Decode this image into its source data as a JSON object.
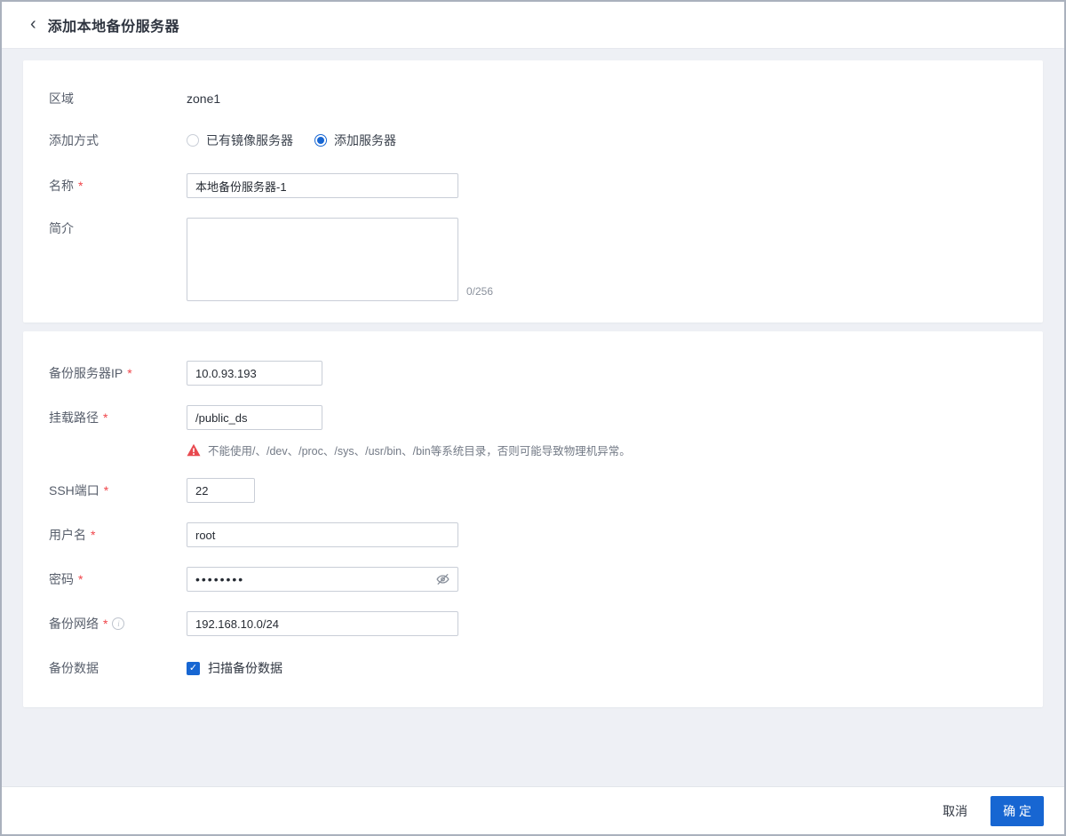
{
  "accent_color": "#1766d2",
  "ui": {
    "required_mark": "*",
    "back_icon": "‹",
    "info_icon": "i",
    "check_icon": "✓"
  },
  "header": {
    "title": "添加本地备份服务器"
  },
  "basic": {
    "zone_label": "区域",
    "zone_value": "zone1",
    "add_method_label": "添加方式",
    "radio_existing_label": "已有镜像服务器",
    "radio_add_label": "添加服务器",
    "radio_selected": "添加服务器",
    "name_label": "名称",
    "name_value": "本地备份服务器-1",
    "desc_label": "简介",
    "desc_value": "",
    "desc_counter": "0/256"
  },
  "server": {
    "ip_label": "备份服务器IP",
    "ip_value": "10.0.93.193",
    "mount_label": "挂载路径",
    "mount_value": "/public_ds",
    "mount_warning": "不能使用/、/dev、/proc、/sys、/usr/bin、/bin等系统目录，否则可能导致物理机异常。",
    "ssh_label": "SSH端口",
    "ssh_value": "22",
    "username_label": "用户名",
    "username_value": "root",
    "password_label": "密码",
    "password_value": "••••••••",
    "network_label": "备份网络",
    "network_value": "192.168.10.0/24",
    "backup_data_label": "备份数据",
    "scan_checkbox_label": "扫描备份数据",
    "scan_checked": true
  },
  "footer": {
    "cancel_label": "取消",
    "confirm_label": "确 定"
  }
}
